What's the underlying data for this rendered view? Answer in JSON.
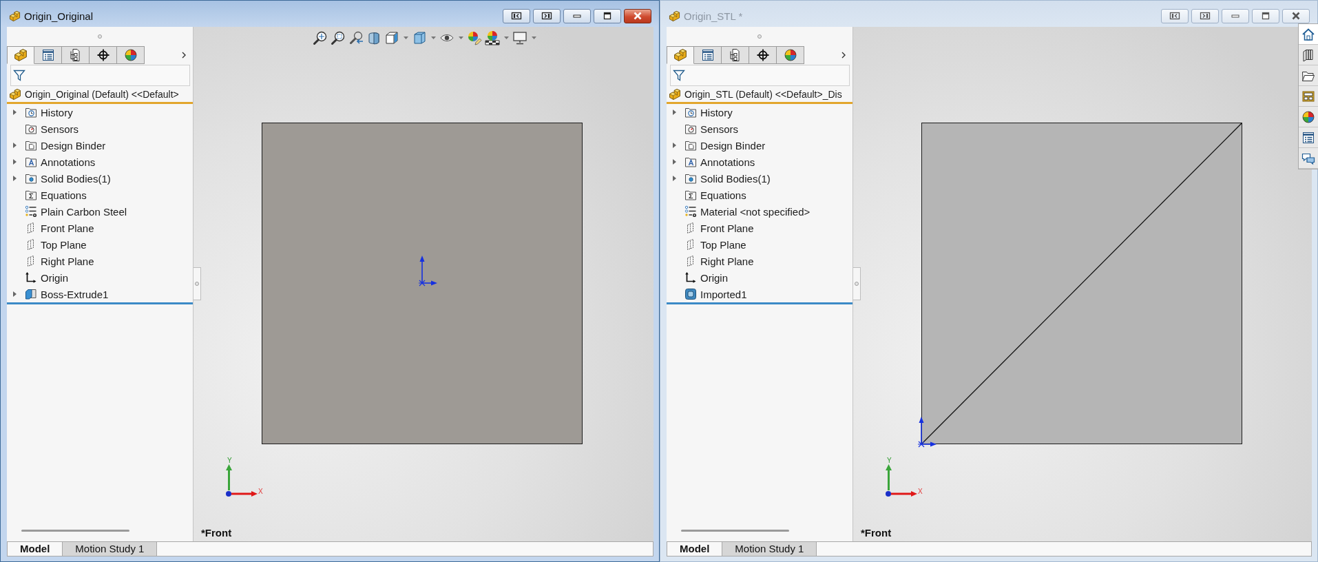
{
  "windows": [
    {
      "title": "Origin_Original",
      "active": true,
      "panel_tabs": [
        {
          "kind": "feature-manager",
          "selected": true
        },
        {
          "kind": "property-manager",
          "selected": false
        },
        {
          "kind": "configuration-manager",
          "selected": false
        },
        {
          "kind": "dimxpert-manager",
          "selected": false
        },
        {
          "kind": "display-manager",
          "selected": false
        }
      ],
      "tree_root": "Origin_Original (Default) <<Default>",
      "tree": [
        {
          "kind": "history",
          "label": "History",
          "expandable": true
        },
        {
          "kind": "sensors",
          "label": "Sensors",
          "expandable": false
        },
        {
          "kind": "design-binder",
          "label": "Design Binder",
          "expandable": true
        },
        {
          "kind": "annotations",
          "label": "Annotations",
          "expandable": true
        },
        {
          "kind": "solid-bodies",
          "label": "Solid Bodies(1)",
          "expandable": true
        },
        {
          "kind": "equations",
          "label": "Equations",
          "expandable": false
        },
        {
          "kind": "material",
          "label": "Plain Carbon Steel",
          "expandable": false
        },
        {
          "kind": "plane",
          "label": "Front Plane",
          "expandable": false
        },
        {
          "kind": "plane",
          "label": "Top Plane",
          "expandable": false
        },
        {
          "kind": "plane",
          "label": "Right Plane",
          "expandable": false
        },
        {
          "kind": "origin",
          "label": "Origin",
          "expandable": false
        },
        {
          "kind": "extrude",
          "label": "Boss-Extrude1",
          "expandable": true
        }
      ],
      "heads_up_toolbar": [
        {
          "kind": "zoom-to-fit",
          "dropdown": false
        },
        {
          "kind": "zoom-to-area",
          "dropdown": false
        },
        {
          "kind": "previous-view",
          "dropdown": false
        },
        {
          "kind": "section-view",
          "dropdown": false
        },
        {
          "kind": "view-orientation",
          "dropdown": true
        },
        {
          "kind": "display-style",
          "dropdown": true
        },
        {
          "kind": "hide-show",
          "dropdown": true
        },
        {
          "kind": "edit-appearance",
          "dropdown": false
        },
        {
          "kind": "apply-scene",
          "dropdown": true
        },
        {
          "kind": "view-settings",
          "dropdown": true
        }
      ],
      "model": {
        "kind": "extruded-solid"
      },
      "triad": {
        "y_label": "Y",
        "x_label": "X"
      },
      "view_label": "*Front",
      "bottom_tabs": [
        {
          "label": "Model",
          "selected": true
        },
        {
          "label": "Motion Study 1",
          "selected": false
        }
      ]
    },
    {
      "title": "Origin_STL *",
      "active": false,
      "panel_tabs": [
        {
          "kind": "feature-manager",
          "selected": true
        },
        {
          "kind": "property-manager",
          "selected": false
        },
        {
          "kind": "configuration-manager",
          "selected": false
        },
        {
          "kind": "dimxpert-manager",
          "selected": false
        },
        {
          "kind": "display-manager",
          "selected": false
        }
      ],
      "tree_root": "Origin_STL (Default) <<Default>_Dis",
      "tree": [
        {
          "kind": "history",
          "label": "History",
          "expandable": true
        },
        {
          "kind": "sensors",
          "label": "Sensors",
          "expandable": false
        },
        {
          "kind": "design-binder",
          "label": "Design Binder",
          "expandable": true
        },
        {
          "kind": "annotations",
          "label": "Annotations",
          "expandable": true
        },
        {
          "kind": "solid-bodies",
          "label": "Solid Bodies(1)",
          "expandable": true
        },
        {
          "kind": "equations",
          "label": "Equations",
          "expandable": false
        },
        {
          "kind": "material",
          "label": "Material <not specified>",
          "expandable": false
        },
        {
          "kind": "plane",
          "label": "Front Plane",
          "expandable": false
        },
        {
          "kind": "plane",
          "label": "Top Plane",
          "expandable": false
        },
        {
          "kind": "plane",
          "label": "Right Plane",
          "expandable": false
        },
        {
          "kind": "origin",
          "label": "Origin",
          "expandable": false
        },
        {
          "kind": "imported",
          "label": "Imported1",
          "expandable": false
        }
      ],
      "model": {
        "kind": "imported-mesh"
      },
      "triad": {
        "y_label": "Y",
        "x_label": "X"
      },
      "view_label": "*Front",
      "bottom_tabs": [
        {
          "label": "Model",
          "selected": true
        },
        {
          "label": "Motion Study 1",
          "selected": false
        }
      ]
    }
  ],
  "task_pane": [
    {
      "kind": "home",
      "selected": true
    },
    {
      "kind": "design-library",
      "selected": false
    },
    {
      "kind": "file-explorer",
      "selected": false
    },
    {
      "kind": "view-palette",
      "selected": false
    },
    {
      "kind": "appearances",
      "selected": false
    },
    {
      "kind": "custom-properties",
      "selected": false
    },
    {
      "kind": "forum",
      "selected": false
    }
  ]
}
